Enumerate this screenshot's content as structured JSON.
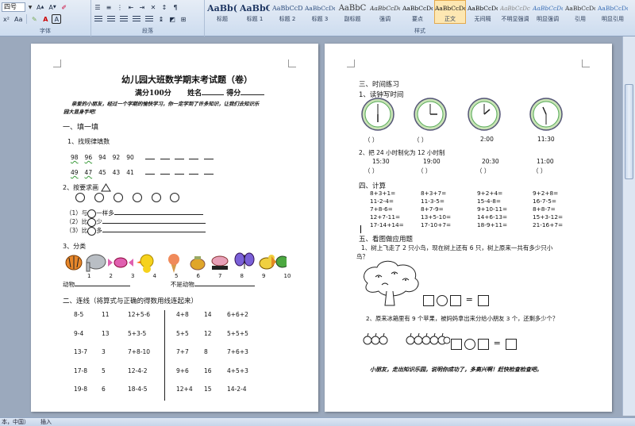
{
  "ribbon": {
    "font_size": "四号",
    "groups": {
      "font": "字体",
      "paragraph": "段落",
      "styles": "样式"
    },
    "styles": [
      {
        "preview": "AaBb(",
        "name": "标题"
      },
      {
        "preview": "AaBbC",
        "name": "标题 1"
      },
      {
        "preview": "AaBbCcD",
        "name": "标题 2"
      },
      {
        "preview": "AaBbCcDd",
        "name": "标题 3"
      },
      {
        "preview": "AaBbC",
        "name": "副标题"
      },
      {
        "preview": "AaBbCcDc",
        "name": "强调"
      },
      {
        "preview": "AaBbCcDd",
        "name": "要点"
      },
      {
        "preview": "AaBbCcDc",
        "name": "正文"
      },
      {
        "preview": "AaBbCcDc",
        "name": "无间隔"
      },
      {
        "preview": "AaBbCcDc",
        "name": "不明显强调"
      },
      {
        "preview": "AaBbCcDc",
        "name": "明显强调"
      },
      {
        "preview": "AaBbCcDc",
        "name": "引用"
      },
      {
        "preview": "AaBbCcDc",
        "name": "明显引用"
      }
    ]
  },
  "left": {
    "title": "幼儿园大班数学期末考试题（卷）",
    "score": "满分100分",
    "name_label": "姓名",
    "grade_label": "得分",
    "intro1": "亲爱的小朋友，经过一个学期的愉快学习，你一定学到了许多知识，让我们去知识乐",
    "intro2": "园大显身手吧!",
    "sec1": "一、填一填",
    "q1": "1、找规律填数",
    "seq1": [
      "98",
      "96",
      "94",
      "92",
      "90"
    ],
    "seq2": [
      "49",
      "47",
      "45",
      "43",
      "41"
    ],
    "q2": "2、按要求画",
    "cmp1a": "（1）与",
    "cmp1b": "一样多",
    "cmp2a": "（2）比",
    "cmp2b": "少",
    "cmp3a": "（3）比",
    "cmp3b": "多",
    "q3": "3、分类",
    "nums": [
      "1",
      "2",
      "3",
      "4",
      "5",
      "6",
      "7",
      "8",
      "9",
      "10"
    ],
    "animal": "动物",
    "not_animal": "不是动物",
    "sec2": "二、连线（将算式与正确的得数用线连起来）",
    "match_rows": [
      [
        "8-5",
        "11",
        "12+5-6",
        "4+8",
        "14",
        "6+6+2"
      ],
      [
        "9-4",
        "13",
        "5+3-5",
        "5+5",
        "12",
        "5+5+5"
      ],
      [
        "13-7",
        "3",
        "7+8-10",
        "7+7",
        "8",
        "7+6+3"
      ],
      [
        "17-8",
        "5",
        "12-4-2",
        "9+6",
        "16",
        "4+5+3"
      ],
      [
        "19-8",
        "6",
        "18-4-5",
        "12+4",
        "15",
        "14-2-4"
      ]
    ]
  },
  "right": {
    "sec3": "三、时间练习",
    "q31": "1、读钟写时间",
    "paren": "（         ）",
    "clock_times": [
      "2:00",
      "11:30"
    ],
    "q32": "2、把 24 小时制化为 12 小时制",
    "times24": [
      "15:30",
      "19:00",
      "20:30",
      "11:00"
    ],
    "sec4": "四、计算",
    "calc": [
      [
        "8+3+1=",
        "8+3+7=",
        "9+2+4=",
        "9+2+8="
      ],
      [
        "11-2-4=",
        "11-3-5=",
        "15-4-8=",
        "16-7-5="
      ],
      [
        "7+8-6=",
        "8+7-9=",
        "9+10-11=",
        "8+8-7="
      ],
      [
        "12+7-11=",
        "13+5-10=",
        "14+6-13=",
        "15+3-12="
      ],
      [
        "17-14+14=",
        "17-10+7=",
        "18-9+11=",
        "21-16+7="
      ]
    ],
    "sec5": "五、看图做应用题",
    "ap1a": "1、树上飞走了 2 只小鸟，现在树上还有 6 只，树上原来一共有多少只小",
    "ap1b": "鸟？",
    "ap2": "2、原来冰箱里有 9 个苹果，被妈妈拿出来分给小朋友 3 个，还剩多少个？",
    "ending": "小朋友，走出知识乐园，说明你成功了，多高兴啊！赶快检查检查吧。",
    "eq_sign": "="
  },
  "status": {
    "lang": "本，中国）",
    "mode": "插入"
  }
}
